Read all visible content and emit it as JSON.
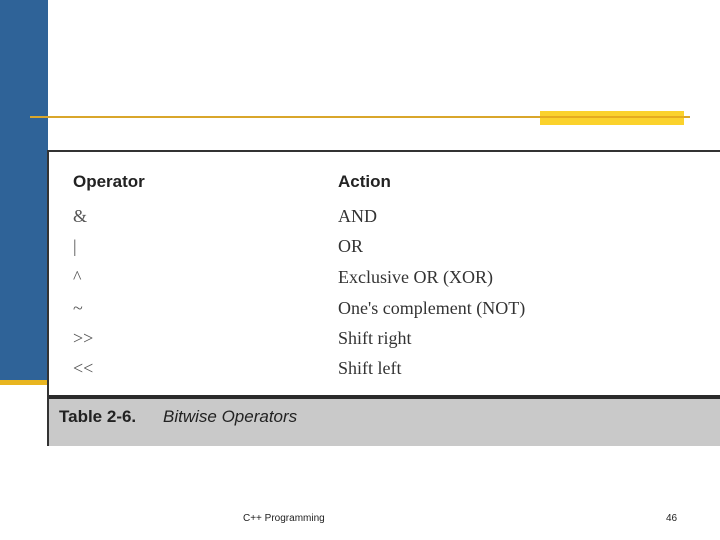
{
  "slide": {
    "accent_blue": "#2f6398",
    "accent_gold": "#e8b520"
  },
  "table": {
    "headers": {
      "operator": "Operator",
      "action": "Action"
    },
    "rows": [
      {
        "operator": "&",
        "action": "AND"
      },
      {
        "operator": "|",
        "action": "OR"
      },
      {
        "operator": "^",
        "action": "Exclusive OR (XOR)"
      },
      {
        "operator": "~",
        "action": "One's complement (NOT)"
      },
      {
        "operator": ">>",
        "action": "Shift right"
      },
      {
        "operator": "<<",
        "action": "Shift left"
      }
    ],
    "caption": {
      "label": "Table  2-6.",
      "title": "Bitwise Operators"
    }
  },
  "footer": {
    "course": "C++ Programming",
    "page_number": "46"
  }
}
